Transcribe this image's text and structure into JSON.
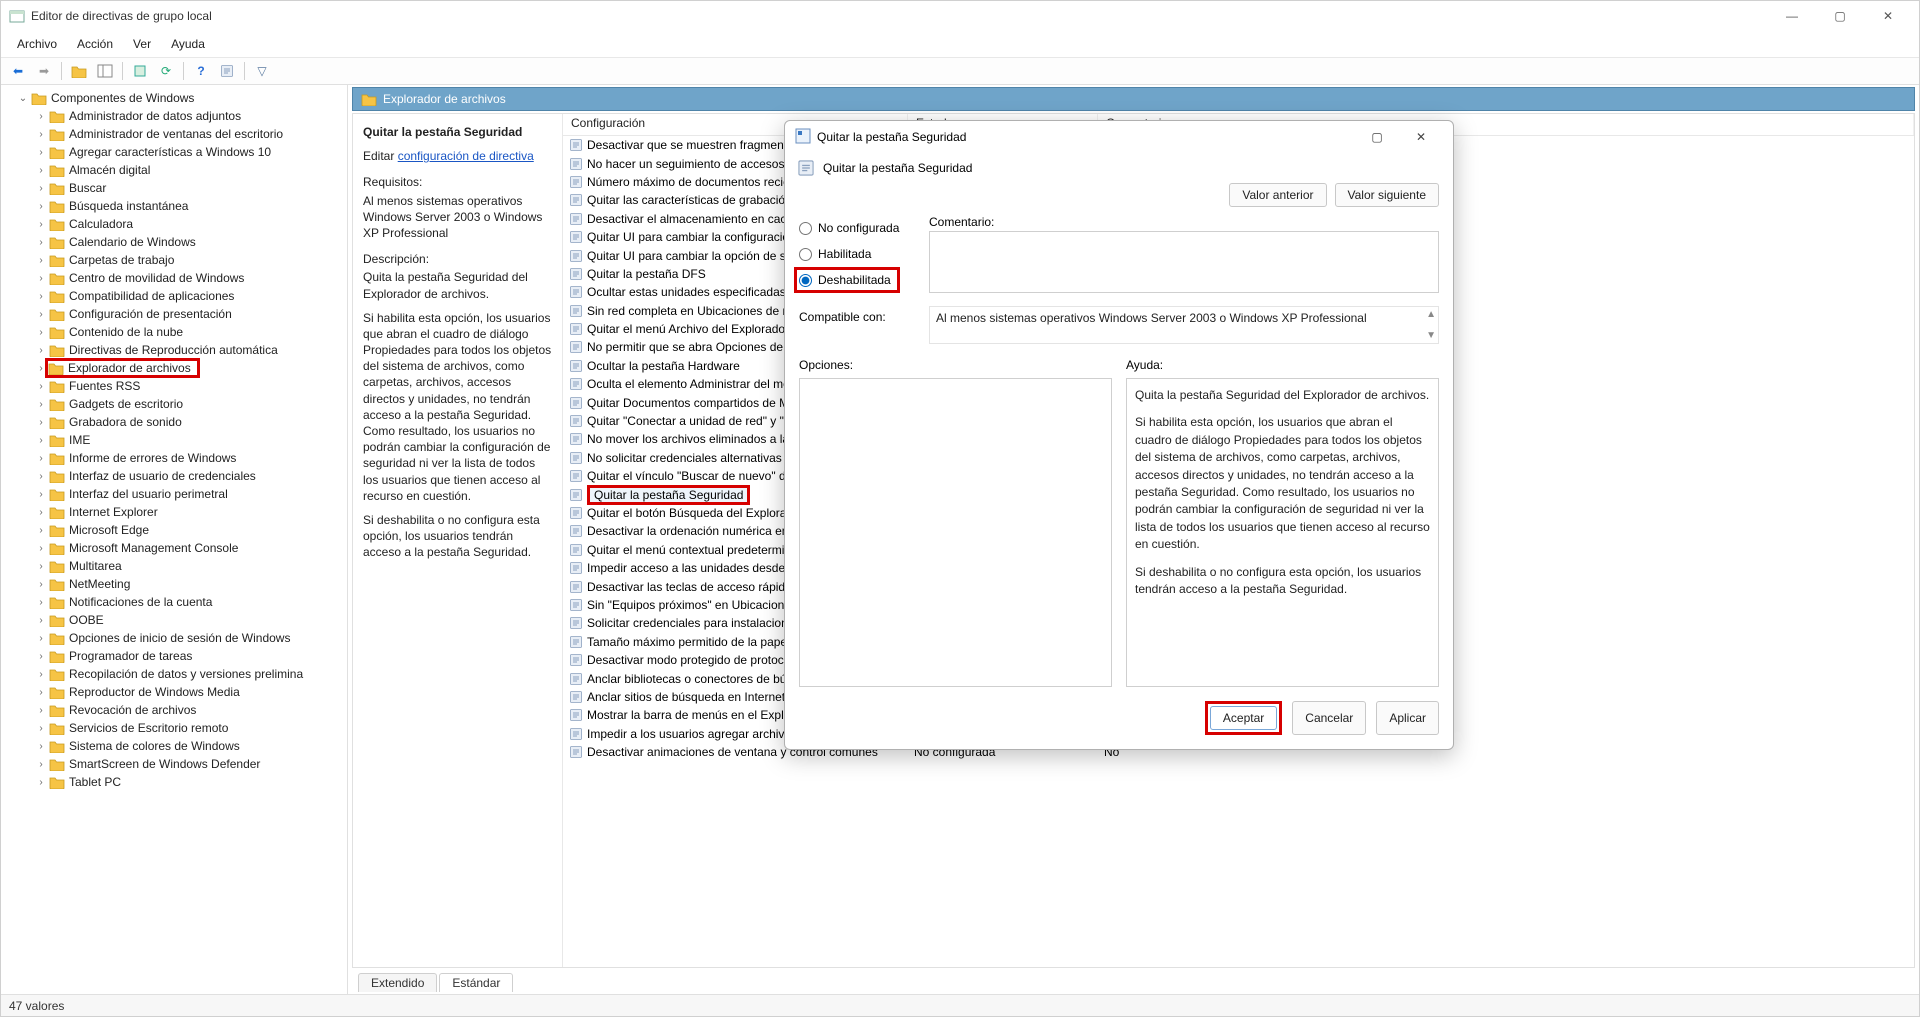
{
  "window": {
    "title": "Editor de directivas de grupo local",
    "menus": [
      "Archivo",
      "Acción",
      "Ver",
      "Ayuda"
    ]
  },
  "tree": {
    "root": "Componentes de Windows",
    "items": [
      "Administrador de datos adjuntos",
      "Administrador de ventanas del escritorio",
      "Agregar características a Windows 10",
      "Almacén digital",
      "Buscar",
      "Búsqueda instantánea",
      "Calculadora",
      "Calendario de Windows",
      "Carpetas de trabajo",
      "Centro de movilidad de Windows",
      "Compatibilidad de aplicaciones",
      "Configuración de presentación",
      "Contenido de la nube",
      "Directivas de Reproducción automática",
      "Explorador de archivos",
      "Fuentes RSS",
      "Gadgets de escritorio",
      "Grabadora de sonido",
      "IME",
      "Informe de errores de Windows",
      "Interfaz de usuario de credenciales",
      "Interfaz del usuario perimetral",
      "Internet Explorer",
      "Microsoft Edge",
      "Microsoft Management Console",
      "Multitarea",
      "NetMeeting",
      "Notificaciones de la cuenta",
      "OOBE",
      "Opciones de inicio de sesión de Windows",
      "Programador de tareas",
      "Recopilación de datos y versiones prelimina",
      "Reproductor de Windows Media",
      "Revocación de archivos",
      "Servicios de Escritorio remoto",
      "Sistema de colores de Windows",
      "SmartScreen de Windows Defender",
      "Tablet PC"
    ],
    "highlight_index": 14
  },
  "path_header": "Explorador de archivos",
  "desc": {
    "setting_title": "Quitar la pestaña Seguridad",
    "edit_prefix": "Editar ",
    "edit_link": "configuración de directiva",
    "req_label": "Requisitos:",
    "req_text": "Al menos sistemas operativos Windows Server 2003 o Windows XP Professional",
    "desc_label": "Descripción:",
    "desc_p1": "Quita la pestaña Seguridad del Explorador de archivos.",
    "desc_p2": "Si habilita esta opción, los usuarios que abran el cuadro de diálogo Propiedades para todos los objetos del sistema de archivos, como carpetas, archivos, accesos directos y unidades, no tendrán acceso a la pestaña Seguridad. Como resultado, los usuarios no podrán cambiar la configuración de seguridad ni ver la lista de todos los usuarios que tienen acceso al recurso en cuestión.",
    "desc_p3": "Si deshabilita o no configura esta opción, los usuarios tendrán acceso a la pestaña Seguridad."
  },
  "columns": {
    "config": "Configuración",
    "state": "Estado",
    "comment": "Comentario"
  },
  "policies": [
    "Desactivar que se muestren fragmentos de código en la vista de contenido",
    "No hacer un seguimiento de accesos directos",
    "Número máximo de documentos recientes",
    "Quitar las características de grabación de CD",
    "Desactivar el almacenamiento en caché de miniaturas",
    "Quitar UI para cambiar la configuración de animación de menú",
    "Quitar UI para cambiar la opción de sugerencias de teclado",
    "Quitar la pestaña DFS",
    "Ocultar estas unidades especificadas en Mi PC",
    "Sin red completa en Ubicaciones de red",
    "Quitar el menú Archivo del Explorador de Windows",
    "No permitir que se abra Opciones de carpeta",
    "Ocultar la pestaña Hardware",
    "Oculta el elemento Administrar del menú Explorador de Windows",
    "Quitar Documentos compartidos de Mi PC",
    "Quitar \"Conectar a unidad de red\" y \"Desconectar unidad de red\"",
    "No mover los archivos eliminados a la papelera de reciclaje",
    "No solicitar credenciales alternativas",
    "Quitar el vínculo \"Buscar de nuevo\" de Explorer",
    "Quitar la pestaña Seguridad",
    "Quitar el botón Búsqueda del Explorador de Windows",
    "Desactivar la ordenación numérica en el Explorador de Windows",
    "Quitar el menú contextual predeterminado",
    "Impedir acceso a las unidades desde Mi PC",
    "Desactivar las teclas de acceso rápido de Windows",
    "Sin \"Equipos próximos\" en Ubicaciones de red",
    "Solicitar credenciales para instalaciones de red",
    "Tamaño máximo permitido de la papelera de reciclaje",
    "Desactivar modo protegido de protocolo de shell",
    "Anclar bibliotecas o conectores de búsqueda",
    "Anclar sitios de búsqueda en Internet a",
    "Mostrar la barra de menús en el Explorador",
    "Impedir a los usuarios agregar archivos a",
    "Desactivar animaciones de ventana y control comunes"
  ],
  "policies_highlight_index": 19,
  "last_row": {
    "state": "No configurada",
    "comment": "No"
  },
  "tabs": {
    "extended": "Extendido",
    "standard": "Estándar"
  },
  "statusbar": "47 valores",
  "dialog": {
    "title": "Quitar la pestaña Seguridad",
    "subhead": "Quitar la pestaña Seguridad",
    "prev_btn": "Valor anterior",
    "next_btn": "Valor siguiente",
    "radio": {
      "not_conf": "No configurada",
      "enabled": "Habilitada",
      "disabled": "Deshabilitada"
    },
    "comment_label": "Comentario:",
    "compat_label": "Compatible con:",
    "compat_value": "Al menos sistemas operativos Windows Server 2003 o Windows XP Professional",
    "options_label": "Opciones:",
    "help_label": "Ayuda:",
    "help_p1": "Quita la pestaña Seguridad del Explorador de archivos.",
    "help_p2": "Si habilita esta opción, los usuarios que abran el cuadro de diálogo Propiedades para todos los objetos del sistema de archivos, como carpetas, archivos, accesos directos y unidades, no tendrán acceso a la pestaña Seguridad. Como resultado, los usuarios no podrán cambiar la configuración de seguridad ni ver la lista de todos los usuarios que tienen acceso al recurso en cuestión.",
    "help_p3": "Si deshabilita o no configura esta opción, los usuarios tendrán acceso a la pestaña Seguridad.",
    "ok": "Aceptar",
    "cancel": "Cancelar",
    "apply": "Aplicar"
  }
}
